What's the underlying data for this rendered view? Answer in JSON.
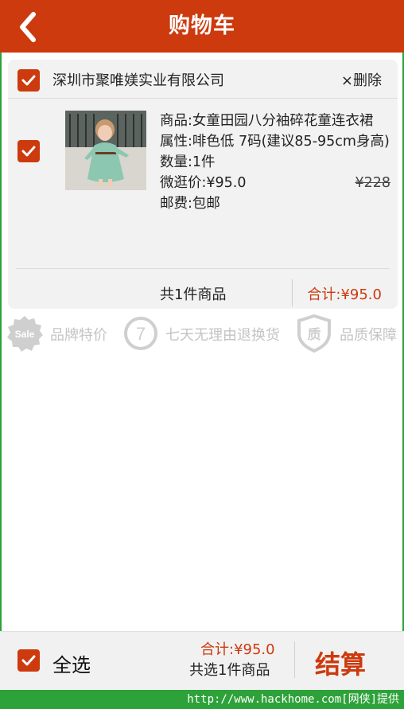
{
  "header": {
    "title": "购物车"
  },
  "store": {
    "name": "深圳市聚唯媄实业有限公司",
    "delete_label": "×删除",
    "checked": true
  },
  "item": {
    "checked": true,
    "name_line": "商品:女童田园八分袖碎花童连衣裙",
    "attr_line": "属性:啡色低 7码(建议85-95cm身高)",
    "quantity_line": "数量:1件",
    "price_line": "微逛价:¥95.0",
    "original_price": "¥228",
    "shipping_line": "邮费:包邮"
  },
  "summary": {
    "count_label": "共1件商品",
    "total_label": "合计:¥95.0"
  },
  "guarantees": [
    {
      "icon": "sale-badge-icon",
      "label": "品牌特价"
    },
    {
      "icon": "seven-day-return-icon",
      "label": "七天无理由退换货"
    },
    {
      "icon": "quality-shield-icon",
      "label": "品质保障"
    }
  ],
  "bottom_bar": {
    "select_all_label": "全选",
    "select_all_checked": true,
    "total_label": "合计:¥95.0",
    "selected_count_label": "共选1件商品",
    "checkout_label": "结算"
  },
  "watermark": "http://www.hackhome.com[网侠]提供",
  "colors": {
    "accent": "#cc3a0e",
    "card_bg": "#f2f2f2",
    "muted_icon": "#c4c4c4",
    "watermark_bg": "#2ea23a"
  }
}
